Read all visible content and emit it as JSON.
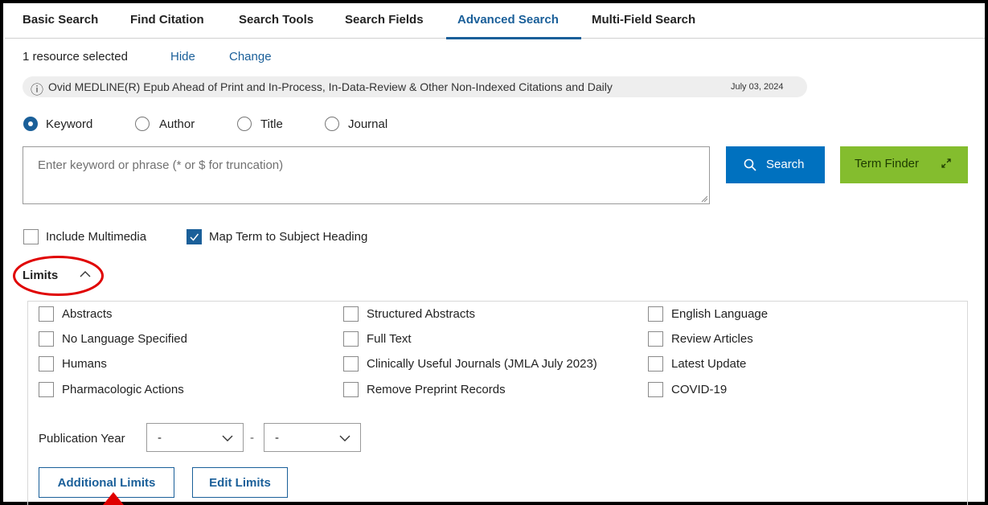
{
  "tabs": [
    {
      "label": "Basic Search"
    },
    {
      "label": "Find Citation"
    },
    {
      "label": "Search Tools"
    },
    {
      "label": "Search Fields"
    },
    {
      "label": "Advanced Search",
      "active": true
    },
    {
      "label": "Multi-Field Search"
    }
  ],
  "resource": {
    "count_text": "1 resource selected",
    "hide_label": "Hide",
    "change_label": "Change",
    "info_glyph": "ⓘ",
    "name": "Ovid MEDLINE(R) Epub Ahead of Print and In-Process, In-Data-Review & Other Non-Indexed Citations and Daily",
    "date": "July 03, 2024"
  },
  "search_type": {
    "options": [
      "Keyword",
      "Author",
      "Title",
      "Journal"
    ],
    "selected": "Keyword"
  },
  "search_input": {
    "placeholder": "Enter keyword or phrase (* or $ for truncation)",
    "value": ""
  },
  "buttons": {
    "search_label": "Search",
    "term_finder_label": "Term Finder"
  },
  "options": {
    "include_multimedia": {
      "label": "Include Multimedia",
      "checked": false
    },
    "map_term": {
      "label": "Map Term to Subject Heading",
      "checked": true
    }
  },
  "limits": {
    "title": "Limits",
    "col1": [
      "Abstracts",
      "No Language Specified",
      "Humans",
      "Pharmacologic Actions"
    ],
    "col2": [
      "Structured Abstracts",
      "Full Text",
      "Clinically Useful Journals (JMLA July 2023)",
      "Remove Preprint Records"
    ],
    "col3": [
      "English Language",
      "Review Articles",
      "Latest Update",
      "COVID-19"
    ],
    "pub_year_label": "Publication Year",
    "year_from": "-",
    "year_separator": "-",
    "year_to": "-",
    "additional_limits_label": "Additional Limits",
    "edit_limits_label": "Edit Limits"
  },
  "colors": {
    "accent": "#1a5f99",
    "search_button": "#0071bf",
    "term_finder_button": "#84bd2e",
    "annotation": "#e00000"
  },
  "icons": [
    "info-icon",
    "search-icon",
    "expand-icon",
    "chevron-up-icon",
    "chevron-down-icon",
    "check-icon"
  ]
}
